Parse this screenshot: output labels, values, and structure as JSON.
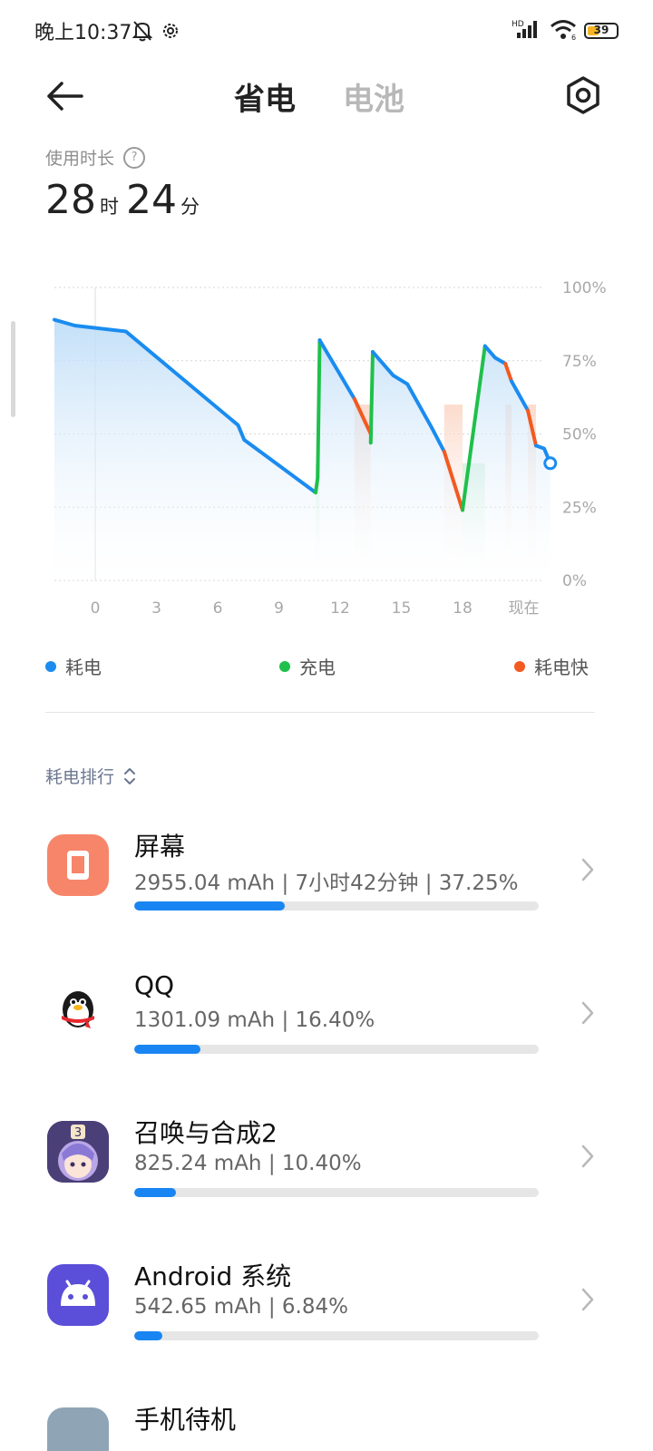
{
  "status_bar": {
    "time": "晚上10:37",
    "battery_level": "39",
    "battery_percent": 39,
    "icons": [
      "bell-off-icon",
      "gear-icon",
      "hd-icon",
      "signal-icon",
      "wifi-icon",
      "battery-icon"
    ]
  },
  "header": {
    "tab_active": "省电",
    "tab_inactive": "电池"
  },
  "usage": {
    "label": "使用时长",
    "hours": "28",
    "hours_unit": "时",
    "minutes": "24",
    "minutes_unit": "分"
  },
  "chart_data": {
    "type": "line",
    "y_ticks": [
      "100%",
      "75%",
      "50%",
      "25%",
      "0%"
    ],
    "x_ticks": [
      "0",
      "3",
      "6",
      "9",
      "12",
      "15",
      "18",
      "现在"
    ],
    "ylim": [
      0,
      100
    ],
    "xlim": [
      -2,
      22
    ],
    "grid": true,
    "colors": {
      "drain": "#1a8cf0",
      "charge": "#1fc04b",
      "fast_drain": "#f25a20",
      "fill": "#cde6fb"
    },
    "series": [
      {
        "name": "耗电",
        "type": "drain",
        "points": [
          [
            -2,
            89
          ],
          [
            -1,
            87
          ],
          [
            1.5,
            85
          ],
          [
            7,
            53
          ],
          [
            7.3,
            48
          ],
          [
            10.8,
            30
          ]
        ]
      },
      {
        "name": "充电",
        "type": "charge",
        "points": [
          [
            10.8,
            30
          ],
          [
            10.9,
            35
          ],
          [
            11,
            82
          ]
        ]
      },
      {
        "name": "耗电",
        "type": "drain",
        "points": [
          [
            11,
            82
          ],
          [
            12.7,
            62
          ]
        ]
      },
      {
        "name": "耗电快",
        "type": "fast_drain",
        "points": [
          [
            12.7,
            62
          ],
          [
            13.5,
            50
          ]
        ]
      },
      {
        "name": "充电",
        "type": "charge",
        "points": [
          [
            13.5,
            47
          ],
          [
            13.6,
            78
          ]
        ]
      },
      {
        "name": "耗电",
        "type": "drain",
        "points": [
          [
            13.6,
            78
          ],
          [
            14.6,
            70
          ],
          [
            15.3,
            67
          ],
          [
            16.5,
            52
          ],
          [
            17.1,
            44
          ]
        ]
      },
      {
        "name": "耗电快",
        "type": "fast_drain",
        "points": [
          [
            17.1,
            44
          ],
          [
            18,
            24
          ]
        ]
      },
      {
        "name": "充电",
        "type": "charge",
        "points": [
          [
            18,
            24
          ],
          [
            19.1,
            80
          ]
        ]
      },
      {
        "name": "耗电",
        "type": "drain",
        "points": [
          [
            19.1,
            80
          ],
          [
            19.6,
            76
          ],
          [
            20.1,
            74
          ]
        ]
      },
      {
        "name": "耗电快",
        "type": "fast_drain",
        "points": [
          [
            20.1,
            74
          ],
          [
            20.4,
            68
          ]
        ]
      },
      {
        "name": "耗电",
        "type": "drain",
        "points": [
          [
            20.4,
            68
          ],
          [
            21.2,
            58
          ]
        ]
      },
      {
        "name": "耗电快",
        "type": "fast_drain",
        "points": [
          [
            21.2,
            58
          ],
          [
            21.6,
            46
          ]
        ]
      },
      {
        "name": "耗电",
        "type": "drain",
        "points": [
          [
            21.6,
            46
          ],
          [
            22,
            45
          ],
          [
            22.3,
            40
          ]
        ]
      }
    ],
    "highlight_bands": [
      [
        12.7,
        13.5
      ],
      [
        17.1,
        18
      ],
      [
        20.1,
        20.4
      ],
      [
        21.2,
        21.6
      ]
    ],
    "charge_bands": [
      [
        10.8,
        11
      ],
      [
        18,
        19.1
      ]
    ],
    "now_point": [
      22.3,
      40
    ]
  },
  "legend": {
    "drain": "耗电",
    "charge": "充电",
    "fast_drain": "耗电快"
  },
  "ranking": {
    "title": "耗电排行",
    "apps": [
      {
        "name": "屏幕",
        "stats": "2955.04 mAh | 7小时42分钟 | 37.25%",
        "percent": 37.25,
        "icon": "screen-icon"
      },
      {
        "name": "QQ",
        "stats": "1301.09 mAh | 16.40%",
        "percent": 16.4,
        "icon": "qq-penguin-icon"
      },
      {
        "name": "召唤与合成2",
        "stats": "825.24 mAh | 10.40%",
        "percent": 10.4,
        "icon": "game-character-icon"
      },
      {
        "name": "Android 系统",
        "stats": "542.65 mAh | 6.84%",
        "percent": 6.84,
        "icon": "android-icon"
      },
      {
        "name": "手机待机",
        "stats": "",
        "percent": 0,
        "icon": "phone-standby-icon"
      }
    ]
  }
}
